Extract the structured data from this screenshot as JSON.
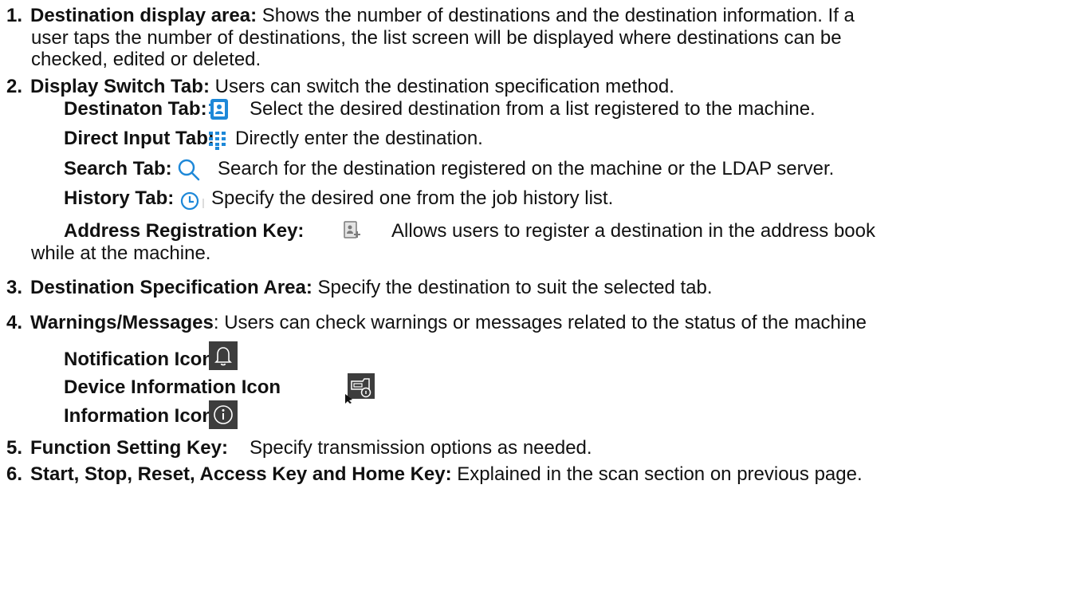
{
  "colors": {
    "accent_blue": "#1e88d8",
    "dark_icon_bg": "#3d3d3d"
  },
  "items": [
    {
      "num": "1.",
      "title": "Destination display area:",
      "text1": " Shows the number of destinations and the destination information.  If a",
      "text2": "user taps the number of destinations, the list screen will be displayed where destinations can be",
      "text3": "checked, edited or deleted."
    },
    {
      "num": "2.",
      "title": "Display Switch Tab:",
      "text": " Users can switch the destination specification method.",
      "sub": [
        {
          "label": "Destinaton Tab:",
          "icon": "address-book-icon",
          "text": "Select the desired destination from a list registered to the machine."
        },
        {
          "label": "Direct Input Tab:",
          "icon": "keypad-icon",
          "text": "Directly enter the destination."
        },
        {
          "label": "Search Tab:",
          "icon": "search-icon",
          "text": "Search for the destination registered on the machine or the LDAP server."
        },
        {
          "label": "History Tab:",
          "icon": "clock-icon",
          "text": "Specify the desired one from the job history list."
        },
        {
          "label": "Address Registration Key:",
          "icon": "address-register-icon",
          "text": "Allows users to register a destination in the address book",
          "text2": "while at the machine."
        }
      ]
    },
    {
      "num": "3.",
      "title": "Destination Specification Area:",
      "text": " Specify the destination to suit the selected tab."
    },
    {
      "num": "4.",
      "title": "Warnings/Messages",
      "text": ": Users can check warnings or messages related to the status of the machine",
      "sub": [
        {
          "label": "Notification Icon",
          "icon": "bell-icon"
        },
        {
          "label": "Device Information Icon",
          "icon": "device-info-icon"
        },
        {
          "label": "Information Icon",
          "icon": "info-icon"
        }
      ]
    },
    {
      "num": "5.",
      "title": "Function Setting Key:",
      "text": "Specify transmission options as needed."
    },
    {
      "num": "6.",
      "title": "Start, Stop, Reset, Access Key and Home Key:",
      "text": " Explained in the scan section on previous page."
    }
  ]
}
